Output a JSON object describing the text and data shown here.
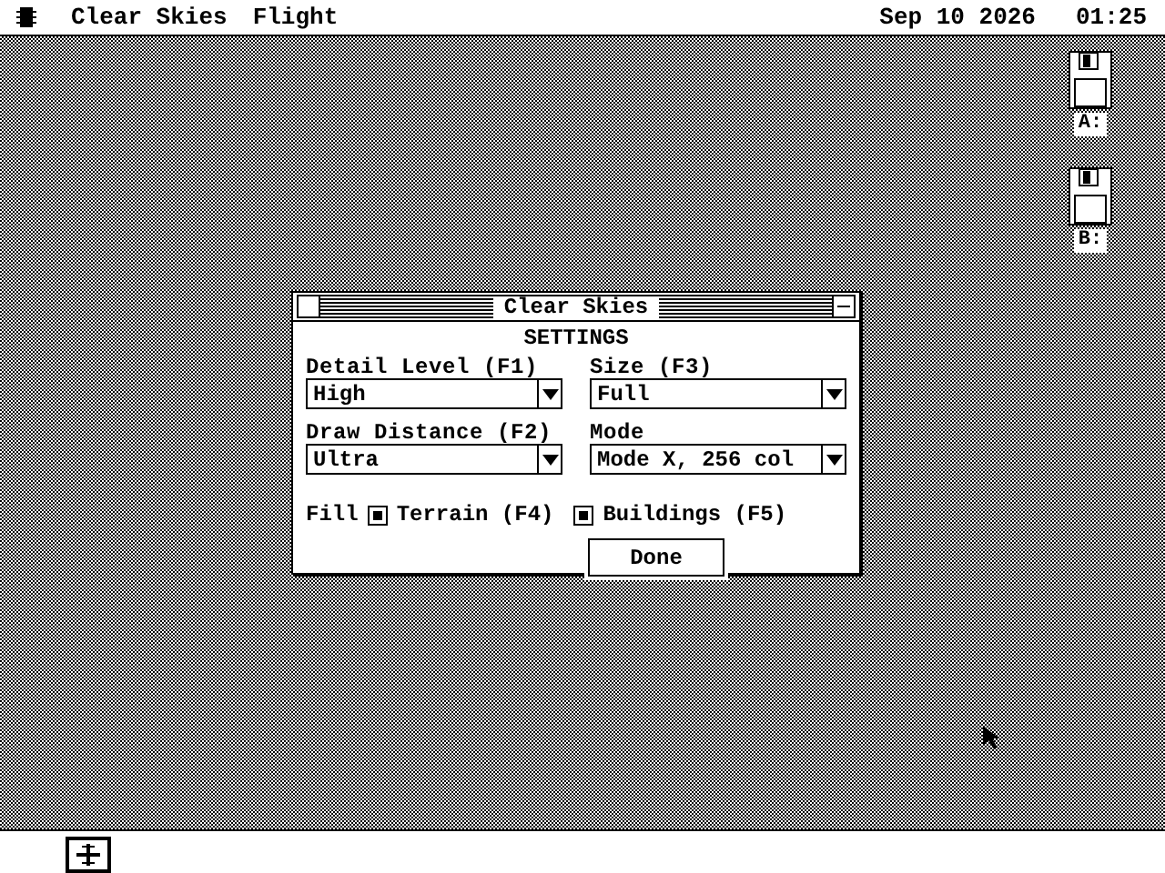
{
  "menu_bar": {
    "menus": [
      "Clear Skies",
      "Flight"
    ],
    "date": "Sep 10 2026",
    "time": "01:25"
  },
  "drives": [
    {
      "label": "A:"
    },
    {
      "label": "B:"
    }
  ],
  "dialog": {
    "title": "Clear Skies",
    "heading": "SETTINGS",
    "fields": [
      {
        "label": "Detail Level (F1)",
        "value": "High"
      },
      {
        "label": "Size (F3)",
        "value": "Full"
      },
      {
        "label": "Draw Distance (F2)",
        "value": "Ultra"
      },
      {
        "label": "Mode",
        "value": "Mode X, 256 col"
      }
    ],
    "fill_label": "Fill",
    "checkboxes": [
      {
        "label": "Terrain (F4)",
        "checked": true
      },
      {
        "label": "Buildings (F5)",
        "checked": true
      }
    ],
    "button": "Done"
  }
}
